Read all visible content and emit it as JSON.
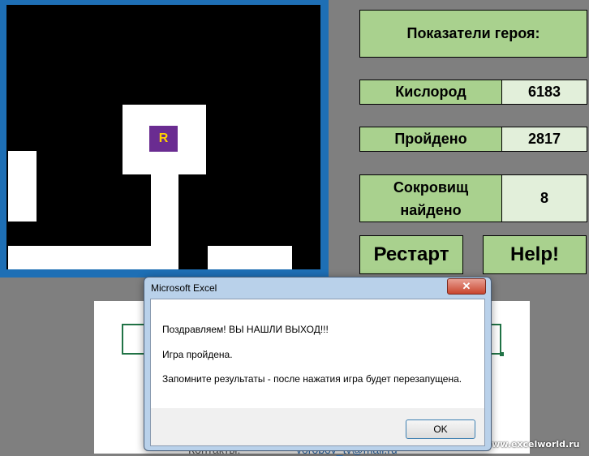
{
  "stats": {
    "header": "Показатели героя:",
    "oxygen_label": "Кислород",
    "oxygen_value": "6183",
    "passed_label": "Пройдено",
    "passed_value": "2817",
    "treasure_label_line1": "Сокровищ",
    "treasure_label_line2": "найдено",
    "treasure_value": "8"
  },
  "buttons": {
    "restart": "Рестарт",
    "help": "Help!"
  },
  "board": {
    "hero_letter": "R"
  },
  "dialog": {
    "title": "Microsoft Excel",
    "close_glyph": "✕",
    "line1": "Поздравляем! ВЫ НАШЛИ ВЫХОД!!!",
    "line2": "Игра пройдена.",
    "line3": "Запомните результаты - после нажатия игра будет перезапущена.",
    "ok": "OK"
  },
  "sheet": {
    "contacts_label": "Контакты:",
    "email": "vorobov_tv@mail.ru"
  },
  "watermark": "www.excelworld.ru",
  "colors": {
    "panel_green": "#a9d18e",
    "value_green": "#e2efda",
    "board_border": "#1e6fb5",
    "hero_bg": "#6a2c91",
    "hero_fg": "#ffd200"
  }
}
